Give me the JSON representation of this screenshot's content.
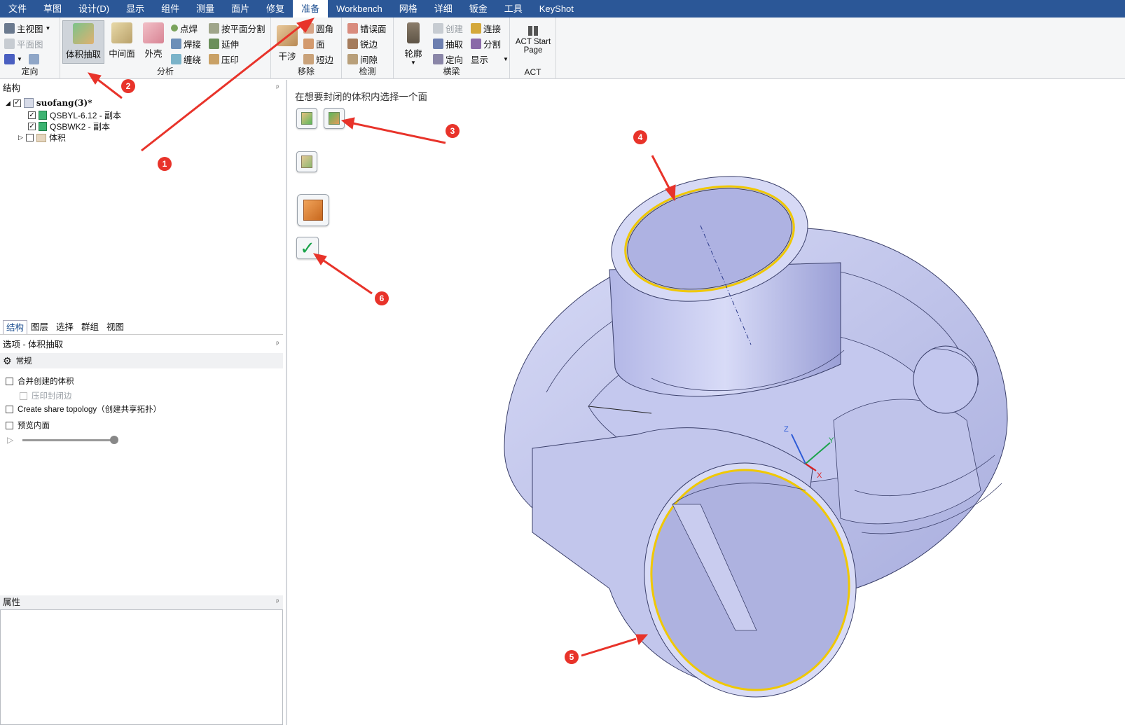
{
  "menu": [
    "文件",
    "草图",
    "设计(D)",
    "显示",
    "组件",
    "测量",
    "面片",
    "修复",
    "准备",
    "Workbench",
    "网格",
    "详细",
    "钣金",
    "工具",
    "KeyShot"
  ],
  "menu_active": "准备",
  "ribbon": {
    "orient": {
      "home": "主视图",
      "plane": "平面图",
      "label": "定向"
    },
    "analysis": {
      "volume_extract": "体积抽取",
      "midsurface": "中间面",
      "shell": "外壳",
      "spot_weld": "点焊",
      "weld": "焊接",
      "wrap": "缠绕",
      "split_by_plane": "按平面分割",
      "extend": "延伸",
      "imprint": "压印",
      "label": "分析"
    },
    "remove": {
      "interference": "干涉",
      "round": "圆角",
      "face": "面",
      "short_edge": "短边",
      "label": "移除"
    },
    "detect": {
      "wrong_face": "错误面",
      "sharp_edge": "锐边",
      "gap": "间隙",
      "label": "检测"
    },
    "beam": {
      "profile": "轮廓",
      "create": "创建",
      "extract": "抽取",
      "orient": "定向",
      "connect": "连接",
      "split": "分割",
      "display": "显示",
      "label": "横梁"
    },
    "act": {
      "start_page": "ACT Start Page",
      "label": "ACT"
    }
  },
  "structure": {
    "title": "结构",
    "root": "suofang(3)*",
    "items": [
      "QSBYL-6.12 - 副本",
      "QSBWK2 - 副本",
      "体积"
    ]
  },
  "tabs": [
    "结构",
    "图层",
    "选择",
    "群组",
    "视图"
  ],
  "options": {
    "title": "选项 - 体积抽取",
    "section": "常规",
    "merge": "合并创建的体积",
    "imprint_close": "压印封闭边",
    "share_topology": "Create share topology（创建共享拓扑）",
    "preview": "预览内面"
  },
  "properties": {
    "title": "属性"
  },
  "viewport": {
    "hint": "在想要封闭的体积内选择一个面"
  },
  "axes": {
    "z": "Z",
    "y": "Y",
    "x": "X"
  },
  "badges": [
    "1",
    "2",
    "3",
    "4",
    "5",
    "6"
  ],
  "colors": {
    "menubar": "#2b5797",
    "model": "#c9cdf0",
    "highlight": "#f0c800",
    "arrow": "#e8332a"
  }
}
